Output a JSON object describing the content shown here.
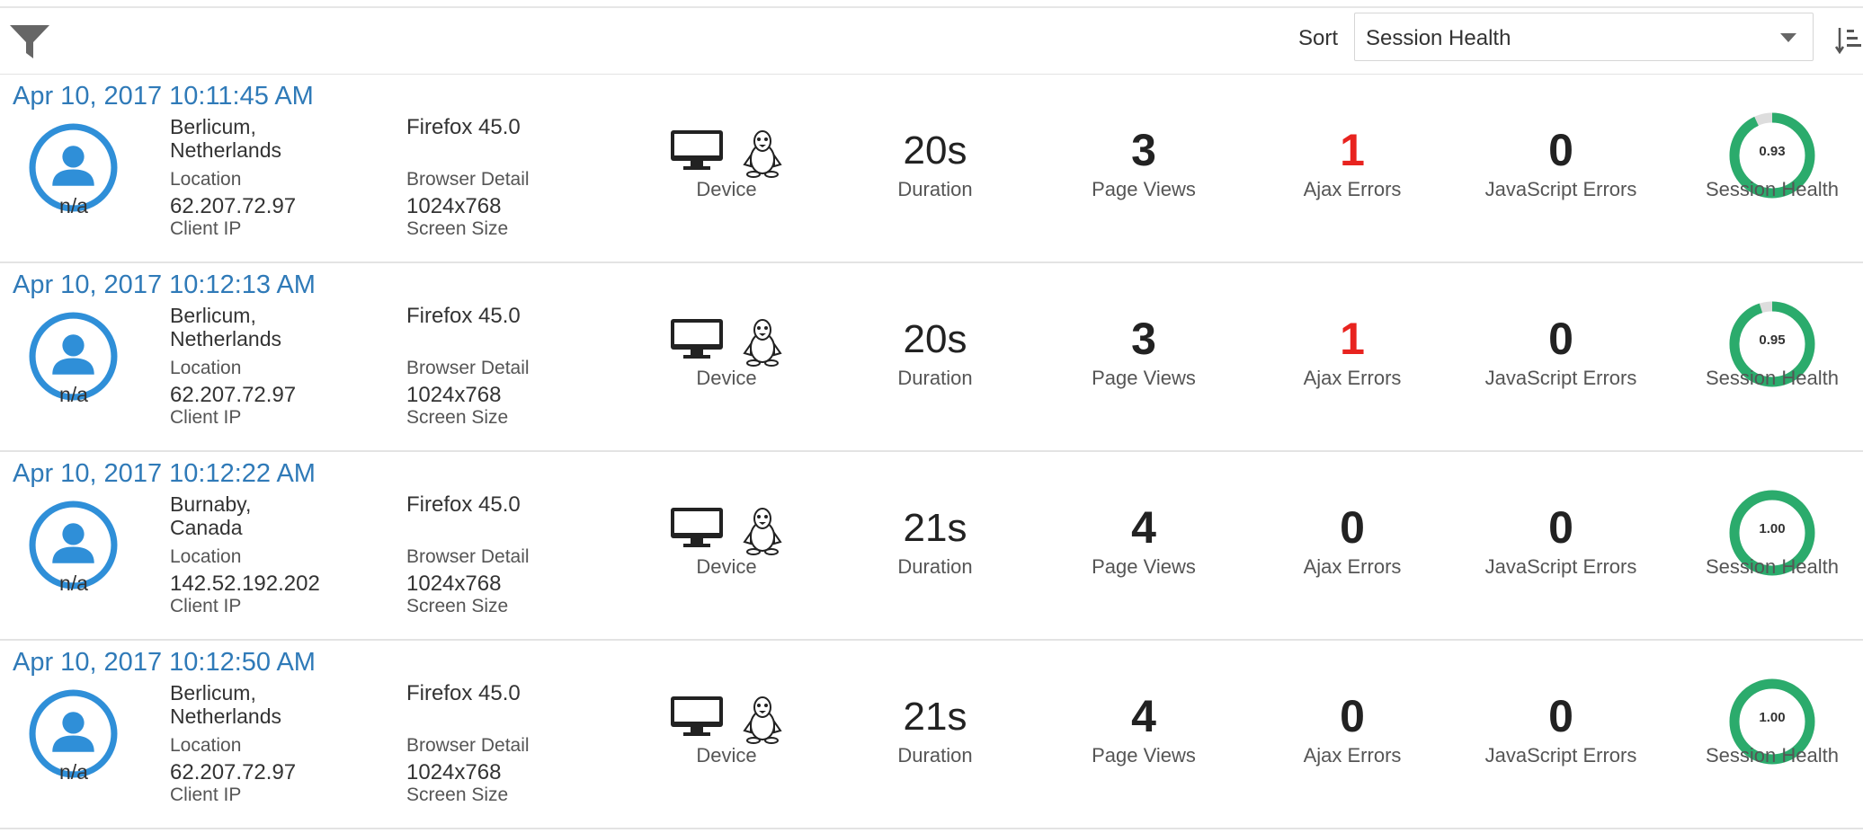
{
  "toolbar": {
    "filter_icon": "filter-funnel-icon",
    "sort_label": "Sort",
    "sort_value": "Session Health",
    "sort_direction_icon": "sort-ascending-icon"
  },
  "labels": {
    "location": "Location",
    "client_ip": "Client IP",
    "browser_detail": "Browser Detail",
    "screen_size": "Screen Size",
    "device": "Device",
    "duration": "Duration",
    "page_views": "Page Views",
    "ajax_errors": "Ajax Errors",
    "javascript_errors": "JavaScript Errors",
    "session_health": "Session Health"
  },
  "colors": {
    "link": "#2f7ab8",
    "error": "#e8231f",
    "health": "#2bab6c",
    "avatar": "#2f8fd8"
  },
  "sessions": [
    {
      "timestamp": "Apr 10, 2017 10:11:45 AM",
      "user": "n/a",
      "location_line1": "Berlicum,",
      "location_line2": "Netherlands",
      "client_ip": "62.207.72.97",
      "browser": "Firefox 45.0",
      "screen_size": "1024x768",
      "device_icons": [
        "desktop-icon",
        "linux-icon"
      ],
      "duration": "20s",
      "page_views": "3",
      "ajax_errors": "1",
      "javascript_errors": "0",
      "session_health": "0.93"
    },
    {
      "timestamp": "Apr 10, 2017 10:12:13 AM",
      "user": "n/a",
      "location_line1": "Berlicum,",
      "location_line2": "Netherlands",
      "client_ip": "62.207.72.97",
      "browser": "Firefox 45.0",
      "screen_size": "1024x768",
      "device_icons": [
        "desktop-icon",
        "linux-icon"
      ],
      "duration": "20s",
      "page_views": "3",
      "ajax_errors": "1",
      "javascript_errors": "0",
      "session_health": "0.95"
    },
    {
      "timestamp": "Apr 10, 2017 10:12:22 AM",
      "user": "n/a",
      "location_line1": "Burnaby,",
      "location_line2": "Canada",
      "client_ip": "142.52.192.202",
      "browser": "Firefox 45.0",
      "screen_size": "1024x768",
      "device_icons": [
        "desktop-icon",
        "linux-icon"
      ],
      "duration": "21s",
      "page_views": "4",
      "ajax_errors": "0",
      "javascript_errors": "0",
      "session_health": "1.00"
    },
    {
      "timestamp": "Apr 10, 2017 10:12:50 AM",
      "user": "n/a",
      "location_line1": "Berlicum,",
      "location_line2": "Netherlands",
      "client_ip": "62.207.72.97",
      "browser": "Firefox 45.0",
      "screen_size": "1024x768",
      "device_icons": [
        "desktop-icon",
        "linux-icon"
      ],
      "duration": "21s",
      "page_views": "4",
      "ajax_errors": "0",
      "javascript_errors": "0",
      "session_health": "1.00"
    }
  ]
}
